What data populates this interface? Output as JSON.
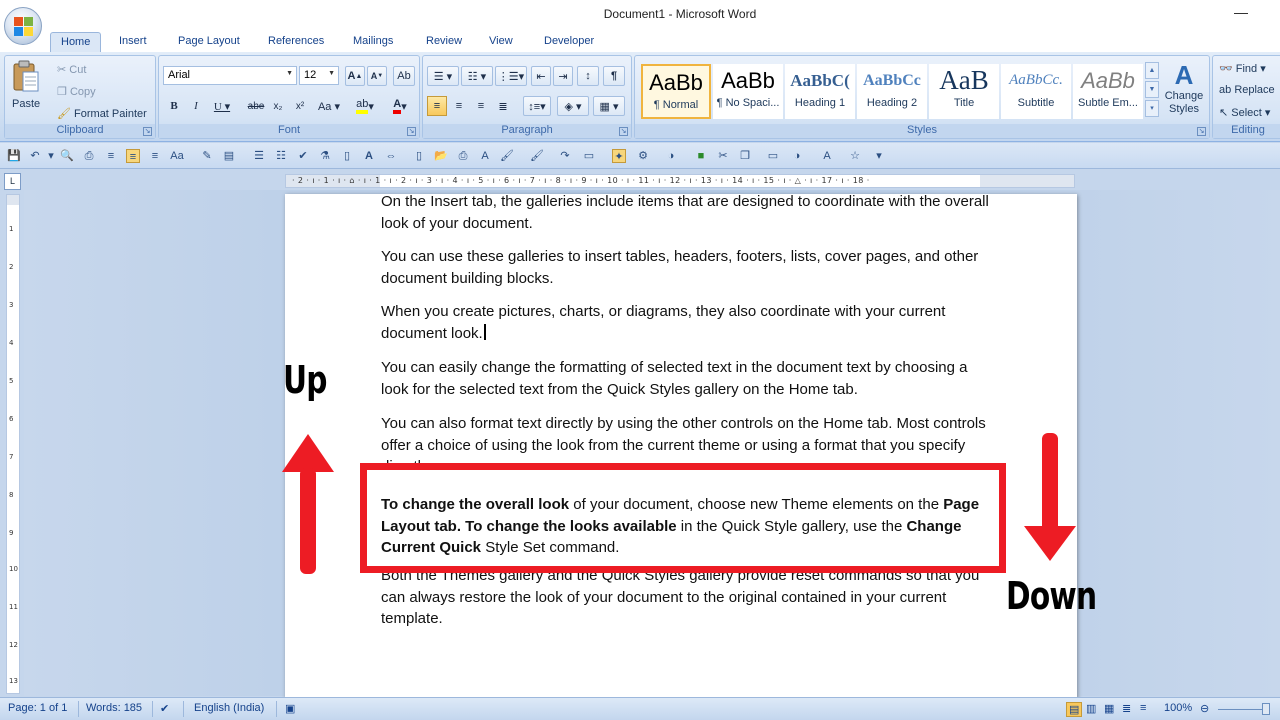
{
  "window": {
    "title": "Document1 - Microsoft Word"
  },
  "tabs": [
    "Home",
    "Insert",
    "Page Layout",
    "References",
    "Mailings",
    "Review",
    "View",
    "Developer"
  ],
  "active_tab": "Home",
  "ribbon": {
    "clipboard": {
      "paste": "Paste",
      "cut": "Cut",
      "copy": "Copy",
      "format_painter": "Format Painter",
      "label": "Clipboard"
    },
    "font": {
      "font_name": "Arial",
      "font_size": "12",
      "label": "Font"
    },
    "paragraph": {
      "label": "Paragraph"
    },
    "styles": {
      "label": "Styles",
      "items": [
        {
          "preview": "AaBb",
          "name": "¶ Normal"
        },
        {
          "preview": "AaBb",
          "name": "¶ No Spaci..."
        },
        {
          "preview": "AaBbC(",
          "name": "Heading 1"
        },
        {
          "preview": "AaBbCc",
          "name": "Heading 2"
        },
        {
          "preview": "AaB",
          "name": "Title"
        },
        {
          "preview": "AaBbCc.",
          "name": "Subtitle"
        },
        {
          "preview": "AaBb",
          "name": "Subtle Em..."
        }
      ],
      "change_styles": "Change Styles"
    },
    "editing": {
      "find": "Find",
      "replace": "Replace",
      "select": "Select",
      "label": "Editing"
    }
  },
  "ruler": {
    "horizontal": "· 2 · ı · 1 · ı · ⌂ · ı · 1 · ı · 2 · ı · 3 · ı · 4 · ı · 5 · ı · 6 · ı · 7 · ı · 8 · ı · 9 · ı · 10 · ı · 11 · ı · 12 · ı · 13 · ı · 14 · ı · 15 · ı · △ · ı · 17 · ı · 18 ·"
  },
  "document": {
    "paragraphs": [
      "On the Insert tab, the galleries include items that are designed to coordinate with the overall look of your document.",
      "You can use these galleries to insert tables, headers, footers, lists, cover pages, and other document building blocks.",
      "When you create pictures, charts, or diagrams, they also coordinate with your current document look.",
      "You can easily change the formatting of selected text in the document text by choosing a look for the selected text from the Quick Styles gallery on the Home tab.",
      "You can also format text directly by using the other controls on the Home tab. Most controls offer a choice of using the look from the current theme or using a format that you specify directly.",
      "Both the Themes gallery and the Quick Styles gallery provide reset commands so that you can always restore the look of your document to the original contained in your current template."
    ],
    "highlight": {
      "bold1": "To change the overall look",
      "text1": " of your document, choose new Theme elements on the ",
      "bold2": "Page Layout tab. To change the looks available",
      "text2": " in the Quick Style gallery, use the ",
      "bold3": "Change Current Quick",
      "text3": " Style Set command."
    }
  },
  "annotations": {
    "up": "Up",
    "down": "Down",
    "arrow_color": "#ed1c24"
  },
  "status": {
    "page": "Page: 1 of 1",
    "words": "Words: 185",
    "language": "English (India)",
    "zoom": "100%"
  }
}
